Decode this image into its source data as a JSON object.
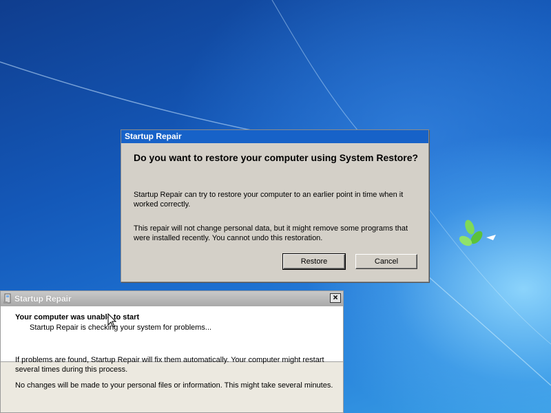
{
  "desktop": {
    "wallpaper": "windows-7-default",
    "colors": {
      "bg_dark": "#0f3d8e",
      "bg_light": "#3aa0e6",
      "leaf": "#6fd14a"
    }
  },
  "restore_dialog": {
    "title": "Startup Repair",
    "heading": "Do you want to restore your computer using System Restore?",
    "paragraph1": "Startup Repair can try to restore your computer to an earlier point in time when it worked correctly.",
    "paragraph2": "This repair will not change personal data, but it might remove some programs that were installed recently. You cannot undo this restoration.",
    "restore_label": "Restore",
    "cancel_label": "Cancel"
  },
  "repair_window": {
    "title": "Startup Repair",
    "close_label": "×",
    "status_title": "Your computer was unable to start",
    "status_sub": "Startup Repair is checking your system for problems...",
    "info1": "If problems are found, Startup Repair will fix them automatically. Your computer might restart several times during this process.",
    "info2": "No changes will be made to your personal files or information. This might take several minutes."
  }
}
